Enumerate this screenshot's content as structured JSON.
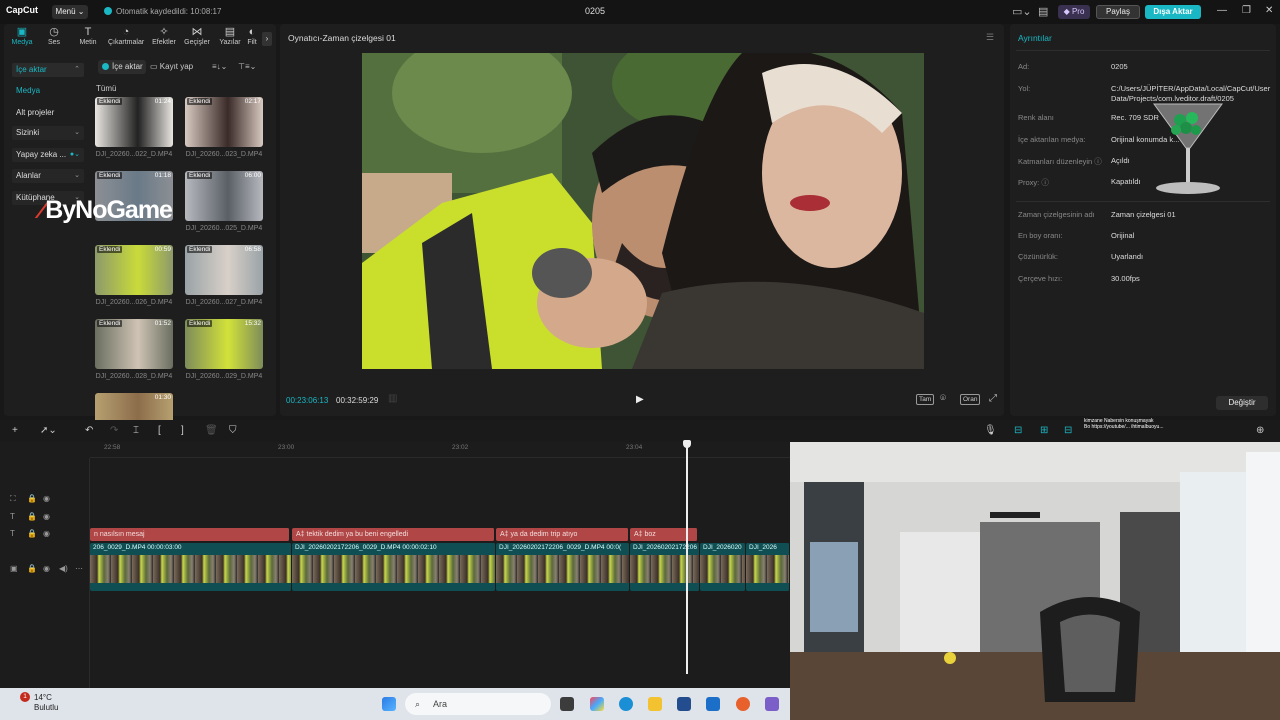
{
  "topbar": {
    "logo": "CapCut",
    "menu": "Menü ⌄",
    "autosave": "Otomatik kaydedildi: 10:08:17",
    "project": "0205",
    "pro": "◆ Pro",
    "share": "Paylaş",
    "export": "Dışa Aktar"
  },
  "tabs": [
    {
      "label": "Medya",
      "icon": "▣"
    },
    {
      "label": "Ses",
      "icon": "◷"
    },
    {
      "label": "Metin",
      "icon": "T"
    },
    {
      "label": "Çıkartmalar",
      "icon": "◔"
    },
    {
      "label": "Efektler",
      "icon": "✧"
    },
    {
      "label": "Geçişler",
      "icon": "⋈"
    },
    {
      "label": "Yazılar",
      "icon": "▤"
    },
    {
      "label": "Filt",
      "icon": "◐"
    }
  ],
  "sidebar": {
    "import": "İçe aktar",
    "media": "Medya",
    "subprojects": "Alt projeler",
    "sizinki": "Sizinki",
    "ai": "Yapay zeka ...",
    "spaces": "Alanlar",
    "library": "Kütüphane"
  },
  "media_toolbar": {
    "import": "İçe aktar",
    "record": "Kayıt yap",
    "all": "Tümü"
  },
  "media_items": [
    {
      "badge": "Eklendi",
      "duration": "01:24",
      "label": "DJI_20260...022_D.MP4"
    },
    {
      "badge": "Eklendi",
      "duration": "02:17",
      "label": "DJI_20260...023_D.MP4"
    },
    {
      "badge": "Eklendi",
      "duration": "01:18",
      "label": ""
    },
    {
      "badge": "Eklendi",
      "duration": "06:00",
      "label": "DJI_20260...025_D.MP4"
    },
    {
      "badge": "Eklendi",
      "duration": "00:59",
      "label": "DJI_20260...026_D.MP4"
    },
    {
      "badge": "Eklendi",
      "duration": "06:58",
      "label": "DJI_20260...027_D.MP4"
    },
    {
      "badge": "Eklendi",
      "duration": "01:52",
      "label": "DJI_20260...028_D.MP4"
    },
    {
      "badge": "Eklendi",
      "duration": "15:32",
      "label": "DJI_20260...029_D.MP4"
    },
    {
      "badge": "",
      "duration": "01:30",
      "label": ""
    }
  ],
  "watermark": "ByNoGame",
  "player": {
    "title": "Oynatıcı-Zaman çizelgesi 01",
    "current": "00:23:06:13",
    "total": "00:32:59:29",
    "full": "Tam",
    "ratio": "Oran"
  },
  "details": {
    "title": "Ayrıntılar",
    "rows": [
      {
        "label": "Ad:",
        "value": "0205"
      },
      {
        "label": "Yol:",
        "value": "C:/Users/JÜPİTER/AppData/Local/CapCut/User Data/Projects/com.lveditor.draft/0205"
      },
      {
        "label": "Renk alanı",
        "value": "Rec. 709 SDR"
      },
      {
        "label": "İçe aktarılan medya:",
        "value": "Orijinal konumda k..."
      },
      {
        "label": "Katmanları düzenleyin ⓘ",
        "value": "Açıldı"
      },
      {
        "label": "Proxy: ⓘ",
        "value": "Kapatıldı"
      },
      {
        "label": "Zaman çizelgesinin adı",
        "value": "Zaman çizelgesi 01"
      },
      {
        "label": "En boy oranı:",
        "value": "Orijinal"
      },
      {
        "label": "Çözünürlük:",
        "value": "Uyarlandı"
      },
      {
        "label": "Çerçeve hızı:",
        "value": "30.00fps"
      }
    ],
    "change": "Değiştir"
  },
  "ruler": [
    "22:58",
    "23:00",
    "23:02",
    "23:04"
  ],
  "text_clips": [
    {
      "label": "n nasılsın mesaj"
    },
    {
      "label": "A‡ tektik dedim ya bu beni engelledi"
    },
    {
      "label": "A‡ ya da dedim trip atıyo"
    },
    {
      "label": "A‡ boz"
    }
  ],
  "video_clips": [
    {
      "label": "206_0029_D.MP4   00:00:03:00"
    },
    {
      "label": "DJI_20260202172206_0029_D.MP4   00:00:02:10"
    },
    {
      "label": "DJI_20260202172206_0029_D.MP4   00:0("
    },
    {
      "label": "DJI_20260202172206"
    },
    {
      "label": "DJI_2026020"
    },
    {
      "label": "DJI_2026"
    }
  ],
  "taskbar": {
    "temp": "14°C",
    "weather": "Bulutlu",
    "badge": "1",
    "search": "Ara"
  },
  "stream_overlay": {
    "line1": "kimzane  Nabersin konuşmayak",
    "line2": "Bo https://youtube/...  ihtimalbuoyu..."
  },
  "colors": {
    "accent": "#1ab8c4",
    "text_clip": "#b04645",
    "video_clip": "#0f4e52"
  }
}
